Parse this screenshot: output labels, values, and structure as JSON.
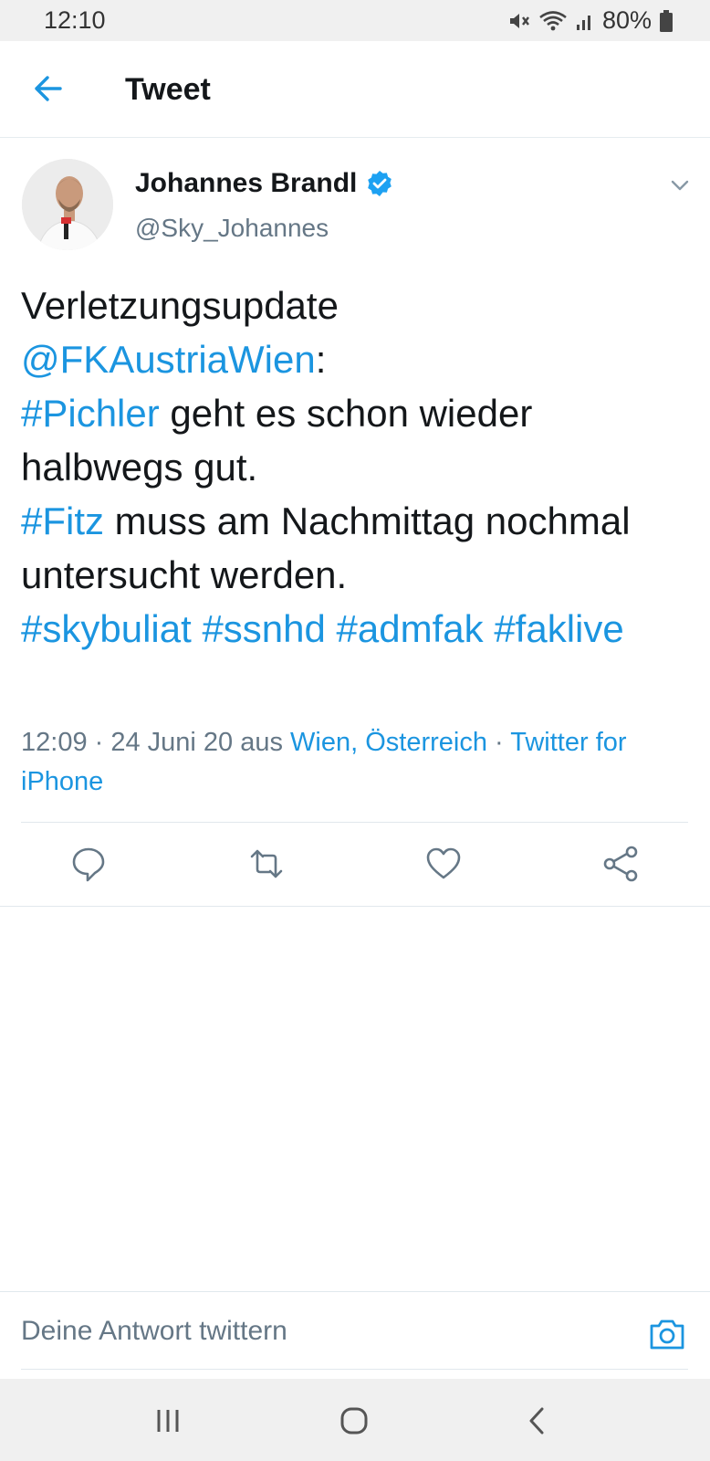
{
  "status_bar": {
    "time": "12:10",
    "battery": "80%"
  },
  "header": {
    "title": "Tweet",
    "back_icon": "arrow-left-icon"
  },
  "tweet": {
    "author_name": "Johannes Brandl",
    "author_handle": "@Sky_Johannes",
    "verified": true,
    "lines": [
      {
        "text": "Verletzungsupdate"
      },
      {
        "mention": "@FKAustriaWien",
        "text": ":"
      },
      {
        "hashtag": "#Pichler",
        "text": " geht es schon wieder halbwegs gut."
      },
      {
        "hashtag": "#Fitz",
        "text": " muss am Nachmittag nochmal untersucht werden."
      },
      {
        "tags": [
          "#skybuliat",
          "#ssnhd",
          "#admfak",
          "#faklive"
        ]
      }
    ],
    "meta": {
      "time_date": "12:09 · 24 Juni 20 aus ",
      "location": "Wien, Österreich",
      "separator": " · ",
      "source": "Twitter for iPhone"
    }
  },
  "actions": [
    "reply-icon",
    "retweet-icon",
    "like-icon",
    "share-icon"
  ],
  "reply_bar": {
    "placeholder": "Deine Antwort twittern",
    "icon": "camera-icon"
  },
  "nav_bar": [
    "recent-apps-icon",
    "home-icon",
    "back-icon"
  ],
  "colors": {
    "accent": "#1b95e0",
    "text": "#14171a",
    "muted": "#657786",
    "divider": "#e1e8ed"
  }
}
